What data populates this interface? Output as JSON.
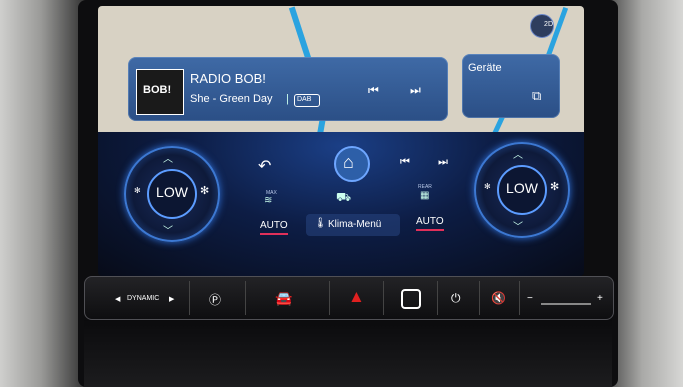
{
  "media": {
    "station_logo": "BOB!",
    "station": "RADIO BOB!",
    "track": "She - Green Day",
    "source_badge": "DAB",
    "prev_icon": "skip-previous-icon",
    "next_icon": "skip-next-icon"
  },
  "devices": {
    "label": "Geräte",
    "icon": "devices-icon"
  },
  "map_view": {
    "mode": "2D"
  },
  "nav": {
    "back_icon": "back-arrow-icon",
    "home_icon": "home-icon",
    "prev_icon": "skip-previous-icon",
    "next_icon": "skip-next-icon"
  },
  "climate": {
    "left_fan": "LOW",
    "right_fan": "LOW",
    "max_label": "MAX",
    "rear_label": "REAR",
    "left_auto": "AUTO",
    "right_auto": "AUTO",
    "menu": "Klima-Menü"
  },
  "strip": {
    "drive_mode": "DYNAMIC",
    "park_icon": "park-camera-icon",
    "car_icon": "vehicle-icon",
    "hazard_icon": "hazard-icon",
    "stop_icon": "stop-button-icon",
    "power_icon": "power-icon",
    "mute_icon": "mute-icon",
    "volume_minus": "−",
    "volume_plus": "+"
  },
  "colors": {
    "accent_blue": "#2aa3e0",
    "auto_underline": "#e0305a",
    "hazard": "#e02020"
  }
}
